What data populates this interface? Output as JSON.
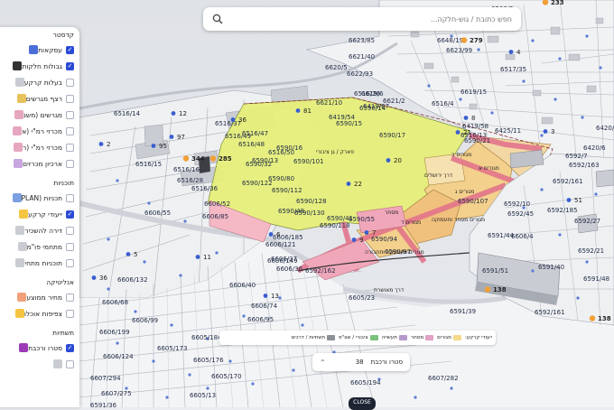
{
  "search": {
    "placeholder": "חפש כתובת / גוש-חלקה..."
  },
  "panel": {
    "sections": [
      {
        "title": "קדסטר",
        "items": [
          {
            "label": "עסקאות",
            "checked": true,
            "swatch": "#4c6ed8"
          },
          {
            "label": "גבולות חלקות",
            "checked": true,
            "swatch": "#333333"
          },
          {
            "label": "בעלות קרקע",
            "checked": false,
            "swatch": "#c9ccd2"
          },
          {
            "label": "רצף מגרשים",
            "checked": false,
            "swatch": "#e8c25a"
          },
          {
            "label": "מגרשים (משנ",
            "checked": false,
            "swatch": "#e7a6c0"
          },
          {
            "label": "מכרזי רמ\"י (א",
            "checked": false,
            "swatch": "#e7a6c0"
          },
          {
            "label": "מכרזי רמ\"י (ר",
            "checked": false,
            "swatch": "#e7a6c0"
          },
          {
            "label": "ארכיון מכרזים",
            "checked": false,
            "swatch": "#c9a6e0"
          }
        ]
      },
      {
        "title": "תוכניות",
        "items": [
          {
            "label": "תכניות (PLAN",
            "checked": false,
            "swatch": "#7aa0e0"
          },
          {
            "label": "ייעודי קרקע",
            "checked": true,
            "swatch": "#f5c542"
          },
          {
            "label": "דירה להשכיר",
            "checked": false,
            "swatch": "#c9ccd2"
          },
          {
            "label": "מתחמי פו\"מ",
            "checked": false,
            "swatch": "#c9ccd2"
          },
          {
            "label": "תוכניות מתחי",
            "checked": false,
            "swatch": "#c9ccd2"
          }
        ]
      },
      {
        "title": "אנליטיקה",
        "items": [
          {
            "label": "מחיר ממוצע",
            "checked": false,
            "swatch": "#f2a07b"
          },
          {
            "label": "צפיפות אוכלו",
            "checked": false,
            "swatch": "#f5c542"
          }
        ]
      },
      {
        "title": "תשתיות",
        "items": [
          {
            "label": "סטרו ורכבת",
            "checked": true,
            "swatch": "#9b3bb5"
          },
          {
            "label": "",
            "checked": false,
            "swatch": "#c9ccd2"
          }
        ]
      }
    ]
  },
  "legend": {
    "items": [
      {
        "label": "ייעודי קרקע:",
        "color": ""
      },
      {
        "label": "מגורים",
        "color": "#f6d88a"
      },
      {
        "label": "מסחר",
        "color": "#e2a0c4"
      },
      {
        "label": "תעשייה",
        "color": "#b79acb"
      },
      {
        "label": "ציבורי / שצ\"פ",
        "color": "#7cc27c"
      },
      {
        "label": "תשתיות / דרכים",
        "color": "#8b8f98"
      }
    ]
  },
  "layer_selector": {
    "label": "סטרו ורכבת",
    "count": "38"
  },
  "bottom_button": "CLOSE",
  "map": {
    "parcels": [
      "6648/19",
      "6621/78",
      "6648/40",
      "6500/2",
      "6623/85",
      "6621/40",
      "6622/93",
      "6620/5",
      "6619/6",
      "6621/2",
      "6623/99",
      "6517/35",
      "6516/4",
      "6619/15",
      "6621/10",
      "6516/26",
      "6419/67",
      "6419/54",
      "6590/15",
      "6590/14",
      "6419/58",
      "6425/11",
      "6516/13",
      "6516/14",
      "6516/15",
      "6516/16",
      "6516/28",
      "6516/36",
      "6516/37",
      "6516/47",
      "6516/48",
      "6516/49",
      "6516/50",
      "6590/13",
      "6590/16",
      "6590/17",
      "6590/21",
      "6590/32",
      "6590/80",
      "6590/101",
      "6590/112",
      "6590/122",
      "6590/128",
      "6590/41",
      "6590/48",
      "6590/55",
      "6590/94",
      "6590/97",
      "6590/118",
      "6590/130",
      "6590/107",
      "6592/162",
      "6592/163",
      "6592/161",
      "6592/7",
      "6592/45",
      "6592/10",
      "6606/4",
      "6606/55",
      "6606/52",
      "6606/85",
      "6606/149",
      "6606/132",
      "6606/185",
      "6606/40",
      "6606/37",
      "6606/36",
      "6606/121",
      "6606/74",
      "6606/95",
      "6606/68",
      "6606/99",
      "6606/199",
      "6606/124",
      "6605/184",
      "6605/173",
      "6605/176",
      "6605/170",
      "6605/13",
      "6605/23",
      "6605/194",
      "6607/282",
      "6607/294",
      "6607/275",
      "6591/36",
      "6591/44",
      "6591/51",
      "6591/39",
      "6591/40",
      "6591/48",
      "6592/161",
      "6592/185",
      "6592/27",
      "6592/21",
      "6420/6",
      "6420/61"
    ],
    "zones": [
      "פארק / גן ציבורי",
      "מגורים ב",
      "מגורים א",
      "מגורים ג",
      "מגורים ד",
      "מגורים מסחר ותעסוקה",
      "מגורים ותעסוקה ותחבורה",
      "דרך ירושלים",
      "דרך מאושרת",
      "מסחר"
    ],
    "markers": [
      "279",
      "233",
      "344",
      "285",
      "138",
      "138",
      "8",
      "21",
      "6",
      "5",
      "11",
      "36",
      "12",
      "95",
      "97",
      "81",
      "36",
      "22",
      "51",
      "2",
      "4",
      "3",
      "7",
      "9",
      "20",
      "13"
    ]
  }
}
